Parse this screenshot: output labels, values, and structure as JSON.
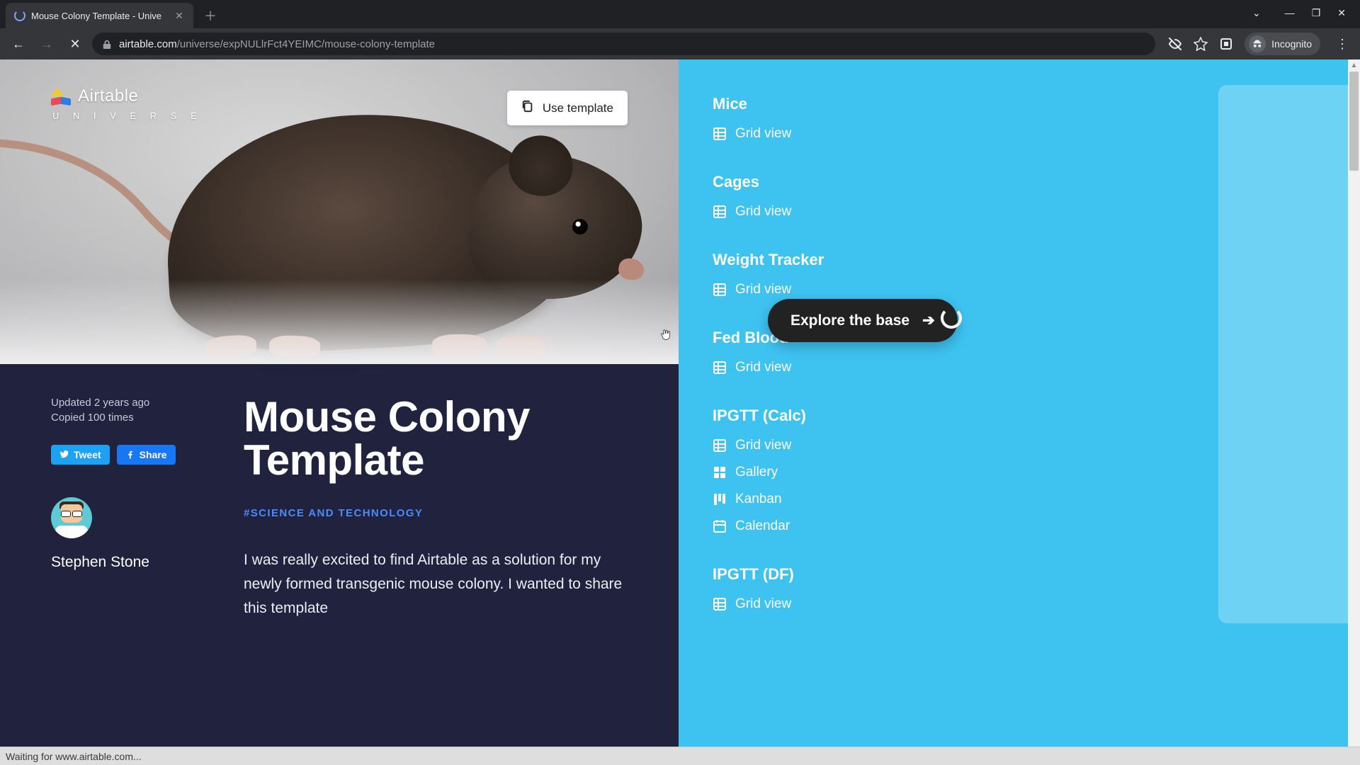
{
  "browser": {
    "tab_title": "Mouse Colony Template - Unive",
    "url_host": "airtable.com",
    "url_path": "/universe/expNULlrFct4YEIMC/mouse-colony-template",
    "incognito_label": "Incognito"
  },
  "logo": {
    "brand": "Airtable",
    "sub": "U N I V E R S E"
  },
  "hero": {
    "use_template_label": "Use template"
  },
  "meta": {
    "updated": "Updated 2 years ago",
    "copied": "Copied 100 times",
    "tweet_label": "Tweet",
    "share_label": "Share",
    "author": "Stephen Stone"
  },
  "article": {
    "title": "Mouse Colony Template",
    "tag": "#SCIENCE AND TECHNOLOGY",
    "body": "I was really excited to find Airtable as a solution for my newly formed transgenic mouse colony. I wanted to share this template"
  },
  "sidebar": {
    "explore_label": "Explore the base",
    "tables": [
      {
        "name": "Mice",
        "views": [
          {
            "type": "grid",
            "label": "Grid view"
          }
        ]
      },
      {
        "name": "Cages",
        "views": [
          {
            "type": "grid",
            "label": "Grid view"
          }
        ]
      },
      {
        "name": "Weight Tracker",
        "views": [
          {
            "type": "grid",
            "label": "Grid view"
          }
        ]
      },
      {
        "name": "Fed Blood",
        "views": [
          {
            "type": "grid",
            "label": "Grid view"
          }
        ]
      },
      {
        "name": "IPGTT (Calc)",
        "views": [
          {
            "type": "grid",
            "label": "Grid view"
          },
          {
            "type": "gallery",
            "label": "Gallery"
          },
          {
            "type": "kanban",
            "label": "Kanban"
          },
          {
            "type": "calendar",
            "label": "Calendar"
          }
        ]
      },
      {
        "name": "IPGTT (DF)",
        "views": [
          {
            "type": "grid",
            "label": "Grid view"
          }
        ]
      }
    ]
  },
  "status_bar": "Waiting for www.airtable.com..."
}
